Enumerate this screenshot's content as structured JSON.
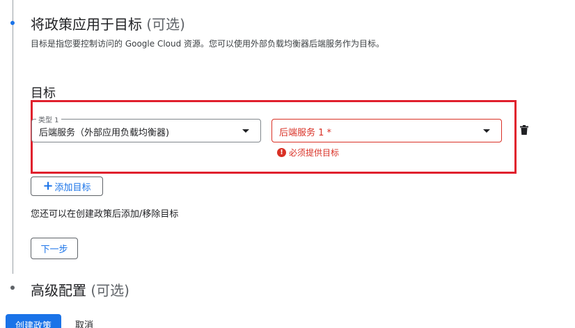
{
  "step1": {
    "title": "将政策应用于目标",
    "optional": "(可选)",
    "description": "目标是指您要控制访问的 Google Cloud 资源。您可以使用外部负载均衡器后端服务作为目标。"
  },
  "targets": {
    "heading": "目标",
    "type_field": {
      "label": "类型 1",
      "value": "后端服务（外部应用负载均衡器)"
    },
    "backend_field": {
      "placeholder": "后端服务 1 *"
    },
    "error": "必须提供目标",
    "add_target_label": "添加目标",
    "note": "您还可以在创建政策后添加/移除目标",
    "next_label": "下一步"
  },
  "step2": {
    "title": "高级配置",
    "optional": "(可选)"
  },
  "footer": {
    "create_label": "创建政策",
    "cancel_label": "取消"
  },
  "icons": {
    "add": "plus-icon",
    "delete": "trash-icon",
    "error": "error-icon",
    "dropdown": "caret-down-icon"
  },
  "colors": {
    "primary": "#1a73e8",
    "error": "#d93025",
    "highlight": "#e0202d"
  }
}
